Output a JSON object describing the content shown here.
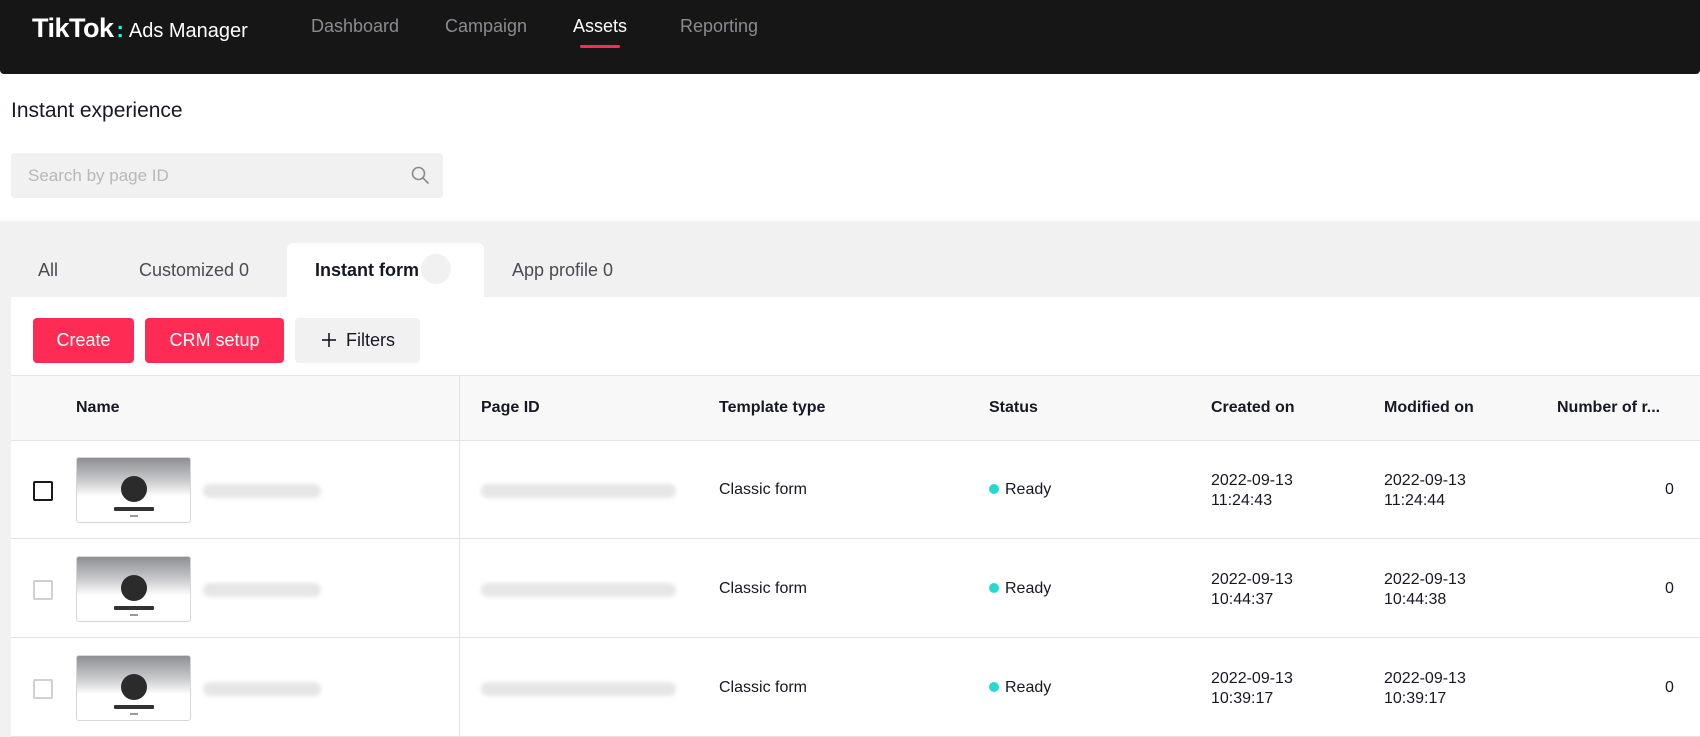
{
  "brand": {
    "main": "TikTok",
    "sub": "Ads Manager"
  },
  "nav": [
    {
      "label": "Dashboard",
      "active": false
    },
    {
      "label": "Campaign",
      "active": false
    },
    {
      "label": "Assets",
      "active": true
    },
    {
      "label": "Reporting",
      "active": false
    }
  ],
  "page": {
    "title": "Instant experience"
  },
  "search": {
    "placeholder": "Search by page ID",
    "value": ""
  },
  "tabs": [
    {
      "label": "All",
      "active": false
    },
    {
      "label": "Customized 0",
      "active": false
    },
    {
      "label": "Instant form",
      "active": true
    },
    {
      "label": "App profile 0",
      "active": false
    }
  ],
  "toolbar": {
    "create_label": "Create",
    "crm_label": "CRM setup",
    "filters_label": "Filters"
  },
  "table": {
    "headers": [
      "Name",
      "Page ID",
      "Template type",
      "Status",
      "Created on",
      "Modified on",
      "Number of r..."
    ],
    "rows": [
      {
        "template": "Classic form",
        "status": "Ready",
        "created_date": "2022-09-13",
        "created_time": "11:24:43",
        "modified_date": "2022-09-13",
        "modified_time": "11:24:44",
        "count": "0"
      },
      {
        "template": "Classic form",
        "status": "Ready",
        "created_date": "2022-09-13",
        "created_time": "10:44:37",
        "modified_date": "2022-09-13",
        "modified_time": "10:44:38",
        "count": "0"
      },
      {
        "template": "Classic form",
        "status": "Ready",
        "created_date": "2022-09-13",
        "created_time": "10:39:17",
        "modified_date": "2022-09-13",
        "modified_time": "10:39:17",
        "count": "0"
      }
    ]
  },
  "colors": {
    "accent": "#fe2c55",
    "status_ready": "#25d9d3",
    "topbar": "#161616"
  }
}
